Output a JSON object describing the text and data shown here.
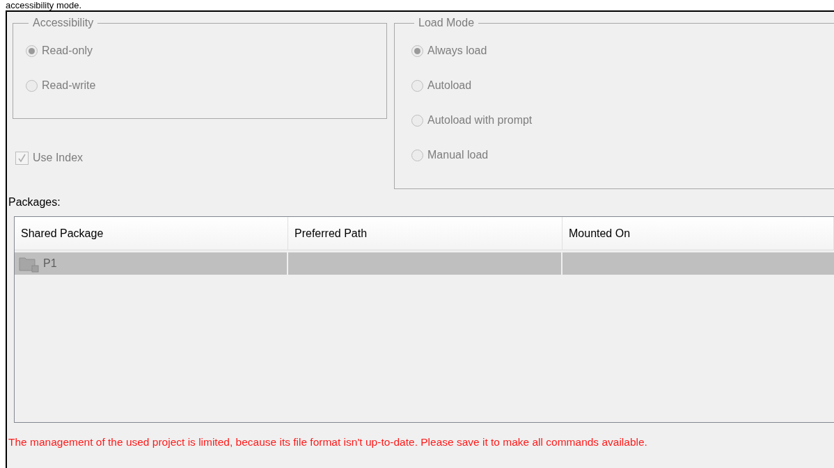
{
  "header_fragment": "accessibility mode.",
  "disabled": true,
  "accessibility": {
    "title": "Accessibility",
    "options": [
      {
        "label": "Read-only",
        "selected": true
      },
      {
        "label": "Read-write",
        "selected": false
      }
    ]
  },
  "use_index": {
    "label": "Use Index",
    "checked": true
  },
  "load_mode": {
    "title": "Load Mode",
    "options": [
      {
        "label": "Always load",
        "selected": true
      },
      {
        "label": "Autoload",
        "selected": false
      },
      {
        "label": "Autoload with prompt",
        "selected": false
      },
      {
        "label": "Manual load",
        "selected": false
      }
    ]
  },
  "packages": {
    "label": "Packages:",
    "columns": [
      "Shared Package",
      "Preferred Path",
      "Mounted On"
    ],
    "rows": [
      {
        "shared_package": "P1",
        "selected": true
      }
    ]
  },
  "message": "The management of the used project is limited, because its file format isn't up-to-date. Please save it to make all commands available."
}
